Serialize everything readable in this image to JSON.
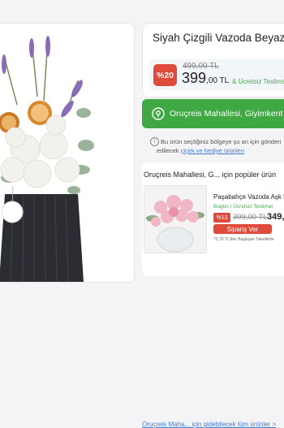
{
  "product": {
    "title": "Siyah Çizgili Vazoda Beyaz",
    "discount_badge": "%20",
    "old_price": "499,00 TL",
    "new_price_int": "399",
    "new_price_cur": ",00 TL",
    "shipping": "& Ücretsiz Teslimat",
    "image_icon": "flower-vase-photo"
  },
  "location": {
    "button_label": "Oruçreis Mahallesi, Giyimkent Sit",
    "icon": "location-pin-icon"
  },
  "info": {
    "line1": "Bu ürün seçtiğiniz bölgeye şu an için gönderi",
    "line2_prefix": "edilecek ",
    "line2_link": "çiçek ve hediye ürünleri"
  },
  "popular": {
    "title": "Oruçreis Mahallesi, G... için popüler ürün",
    "item": {
      "name": "Paşabahçe Vazoda Aşk P",
      "shipping": "Bugün / Ücretsiz Teslimat",
      "badge": "%13",
      "old_price": "399,00 TL",
      "new_price": "349,",
      "order_label": "Sipariş Ver",
      "note": "72,70 TL'den Başlayan Taksitlerle"
    },
    "all_link": "Oruçreis Maha... için gidebilecek tüm ürünler >"
  },
  "colors": {
    "accent_green": "#3fa842",
    "discount_red": "#e04a3a",
    "link_blue": "#3e7ad8"
  }
}
